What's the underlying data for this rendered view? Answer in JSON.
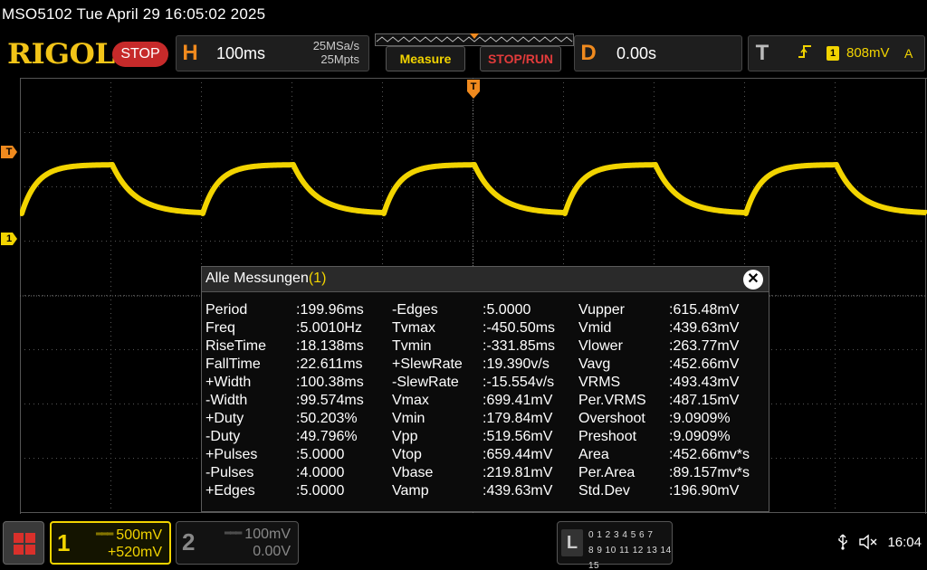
{
  "titlebar": {
    "text": "MSO5102  Tue April 29 16:05:02 2025"
  },
  "header": {
    "logo": "RIGOL",
    "run_state": "STOP",
    "horizontal": {
      "letter": "H",
      "timebase": "100ms",
      "sample_rate": "25MSa/s",
      "memory_depth": "25Mpts"
    },
    "measure_button": "Measure",
    "stoprun_button": "STOP/RUN",
    "delay": {
      "letter": "D",
      "value": "0.00s"
    },
    "trigger": {
      "letter": "T",
      "channel": "1",
      "level": "808mV",
      "mode": "A"
    }
  },
  "markers": {
    "trigger_level": "T",
    "channel1_ground": "1"
  },
  "waveform": {
    "color": "#f2d400",
    "period_divisions": 2.0,
    "high_level_mV": 659.44,
    "low_level_mV": 219.81
  },
  "dialog": {
    "title": "Alle Messungen",
    "count": "(1)",
    "columns": [
      [
        {
          "name": "Period",
          "value": ":199.96ms"
        },
        {
          "name": "Freq",
          "value": ":5.0010Hz"
        },
        {
          "name": "RiseTime",
          "value": ":18.138ms"
        },
        {
          "name": "FallTime",
          "value": ":22.611ms"
        },
        {
          "name": "+Width",
          "value": ":100.38ms"
        },
        {
          "name": "-Width",
          "value": ":99.574ms"
        },
        {
          "name": "+Duty",
          "value": ":50.203%"
        },
        {
          "name": "-Duty",
          "value": ":49.796%"
        },
        {
          "name": "+Pulses",
          "value": ":5.0000"
        },
        {
          "name": "-Pulses",
          "value": ":4.0000"
        },
        {
          "name": "+Edges",
          "value": ":5.0000"
        }
      ],
      [
        {
          "name": "-Edges",
          "value": ":5.0000"
        },
        {
          "name": "Tvmax",
          "value": ":-450.50ms"
        },
        {
          "name": "Tvmin",
          "value": ":-331.85ms"
        },
        {
          "name": "+SlewRate",
          "value": ":19.390v/s"
        },
        {
          "name": "-SlewRate",
          "value": ":-15.554v/s"
        },
        {
          "name": "Vmax",
          "value": ":699.41mV"
        },
        {
          "name": "Vmin",
          "value": ":179.84mV"
        },
        {
          "name": "Vpp",
          "value": ":519.56mV"
        },
        {
          "name": "Vtop",
          "value": ":659.44mV"
        },
        {
          "name": "Vbase",
          "value": ":219.81mV"
        },
        {
          "name": "Vamp",
          "value": ":439.63mV"
        }
      ],
      [
        {
          "name": "Vupper",
          "value": ":615.48mV"
        },
        {
          "name": "Vmid",
          "value": ":439.63mV"
        },
        {
          "name": "Vlower",
          "value": ":263.77mV"
        },
        {
          "name": "Vavg",
          "value": ":452.66mV"
        },
        {
          "name": "VRMS",
          "value": ":493.43mV"
        },
        {
          "name": "Per.VRMS",
          "value": ":487.15mV"
        },
        {
          "name": "Overshoot",
          "value": ":9.0909%"
        },
        {
          "name": "Preshoot",
          "value": ":9.0909%"
        },
        {
          "name": "Area",
          "value": ":452.66mv*s"
        },
        {
          "name": "Per.Area",
          "value": ":89.157mv*s"
        },
        {
          "name": "Std.Dev",
          "value": ":196.90mV"
        }
      ]
    ]
  },
  "bottom": {
    "ch1": {
      "num": "1",
      "scale": "500mV",
      "offset": "+520mV"
    },
    "ch2": {
      "num": "2",
      "scale": "100mV",
      "offset": "0.00V"
    },
    "logic": {
      "letter": "L",
      "row1": "0 1 2 3  4 5 6 7",
      "row2": "8 9 10 11 12 13 14 15"
    },
    "usb_icon": "usb-icon",
    "sound_icon": "speaker-muted-icon",
    "clock": "16:04"
  }
}
